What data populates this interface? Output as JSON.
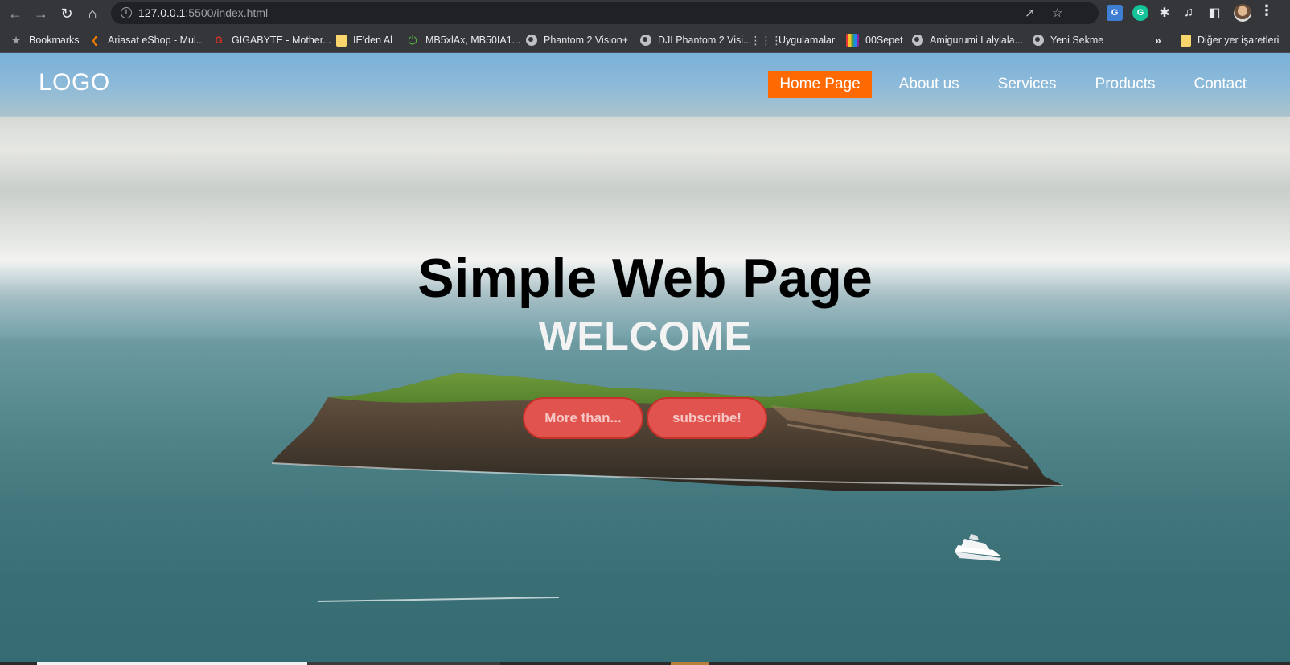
{
  "browser": {
    "url_host": "127.0.0.1",
    "url_rest": ":5500/index.html",
    "bookmarks": [
      {
        "label": "Bookmarks",
        "icon": "star-icon"
      },
      {
        "label": "Ariasat eShop - Mul...",
        "icon": "ariasat-icon"
      },
      {
        "label": "GIGABYTE - Mother...",
        "icon": "gigabyte-icon"
      },
      {
        "label": "IE'den Al",
        "icon": "folder-icon"
      },
      {
        "label": "MB5xlAx, MB50IA1...",
        "icon": "power-icon"
      },
      {
        "label": "Phantom 2 Vision+",
        "icon": "globe-icon"
      },
      {
        "label": "DJI Phantom 2 Visi...",
        "icon": "globe-icon"
      },
      {
        "label": "Uygulamalar",
        "icon": "apps-grid-icon"
      },
      {
        "label": "00Sepet",
        "icon": "sepet-icon"
      },
      {
        "label": "Amigurumi Lalylala...",
        "icon": "globe-icon"
      },
      {
        "label": "Yeni Sekme",
        "icon": "globe-icon"
      }
    ],
    "other_bookmarks": "Diğer yer işaretleri",
    "overflow": "»"
  },
  "site": {
    "logo": "LOGO",
    "nav": [
      {
        "label": "Home Page",
        "active": true
      },
      {
        "label": "About us",
        "active": false
      },
      {
        "label": "Services",
        "active": false
      },
      {
        "label": "Products",
        "active": false
      },
      {
        "label": "Contact",
        "active": false
      }
    ],
    "hero_title": "Simple Web Page",
    "hero_subtitle": "WELCOME",
    "buttons": [
      "More than...",
      "subscribe!"
    ]
  },
  "colors": {
    "nav_active_bg": "#ff6a00",
    "hero_button_bg": "#e0534e",
    "hero_button_border": "#c8302b"
  }
}
